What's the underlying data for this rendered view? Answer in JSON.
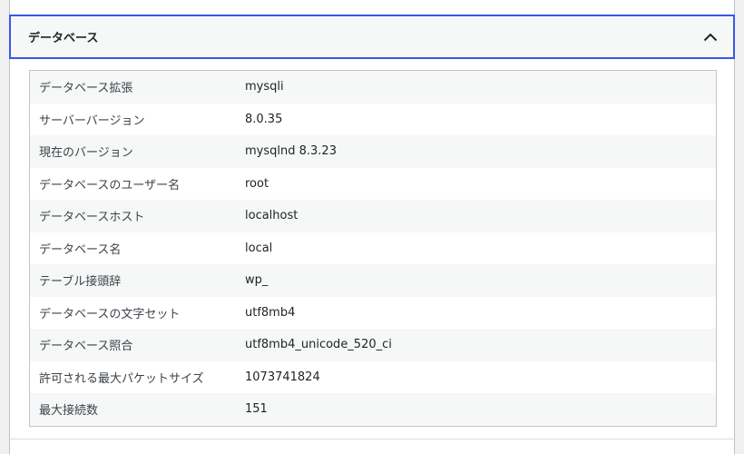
{
  "section": {
    "title": "データベース",
    "rows": [
      {
        "key": "データベース拡張",
        "value": "mysqli"
      },
      {
        "key": "サーバーバージョン",
        "value": "8.0.35"
      },
      {
        "key": "現在のバージョン",
        "value": "mysqlnd 8.3.23"
      },
      {
        "key": "データベースのユーザー名",
        "value": "root"
      },
      {
        "key": "データベースホスト",
        "value": "localhost"
      },
      {
        "key": "データベース名",
        "value": "local"
      },
      {
        "key": "テーブル接頭辞",
        "value": "wp_"
      },
      {
        "key": "データベースの文字セット",
        "value": "utf8mb4"
      },
      {
        "key": "データベース照合",
        "value": "utf8mb4_unicode_520_ci"
      },
      {
        "key": "許可される最大パケットサイズ",
        "value": "1073741824"
      },
      {
        "key": "最大接続数",
        "value": "151"
      }
    ]
  },
  "icons": {
    "toggle": "chevron-up-icon"
  },
  "colors": {
    "focus_border": "#3858e9",
    "row_alt": "#f6f7f7",
    "border": "#c3c4c7"
  }
}
